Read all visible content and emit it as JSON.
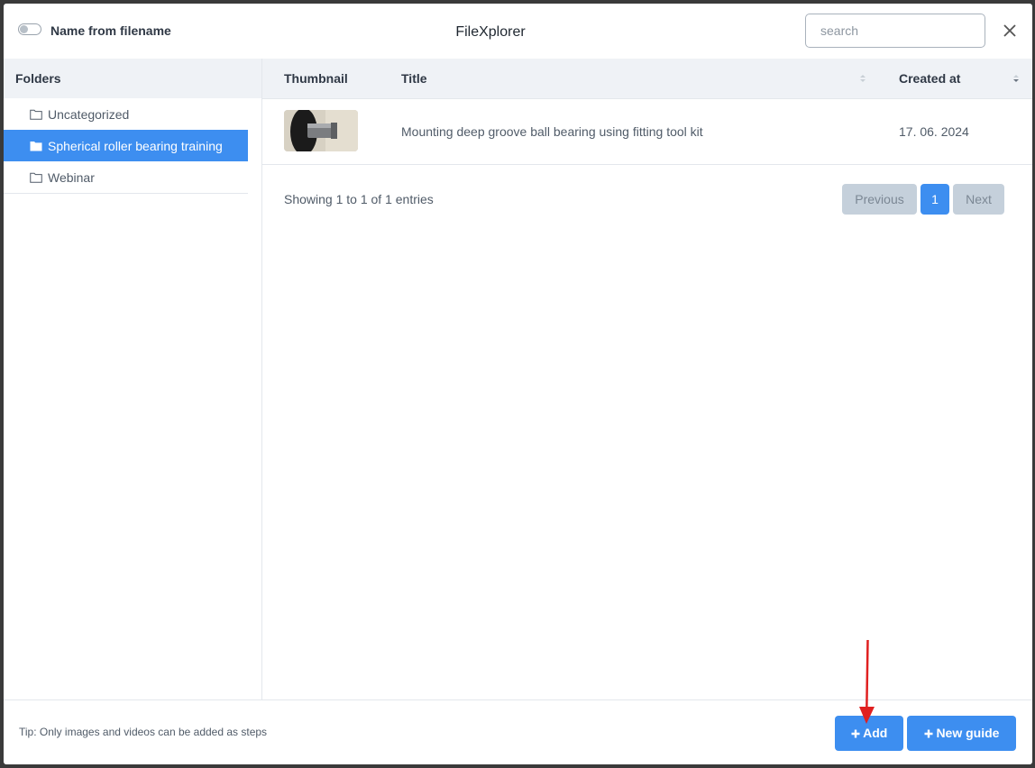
{
  "header": {
    "toggle_label": "Name from filename",
    "title": "FileXplorer",
    "search_placeholder": "search"
  },
  "sidebar": {
    "heading": "Folders",
    "folders": [
      {
        "label": "Uncategorized",
        "active": false
      },
      {
        "label": "Spherical roller bearing training",
        "active": true
      },
      {
        "label": "Webinar",
        "active": false
      }
    ]
  },
  "table": {
    "columns": [
      "Thumbnail",
      "Title",
      "Created at"
    ],
    "rows": [
      {
        "title": "Mounting deep groove ball bearing using fitting tool kit",
        "created_at": "17. 06. 2024"
      }
    ],
    "info": "Showing 1 to 1 of 1 entries"
  },
  "pagination": {
    "previous": "Previous",
    "current": "1",
    "next": "Next"
  },
  "footer": {
    "tip": "Tip: Only images and videos can be added as steps",
    "add_label": "Add",
    "new_guide_label": "New guide"
  },
  "colors": {
    "accent": "#3d8ef0",
    "arrow": "#e02020"
  }
}
